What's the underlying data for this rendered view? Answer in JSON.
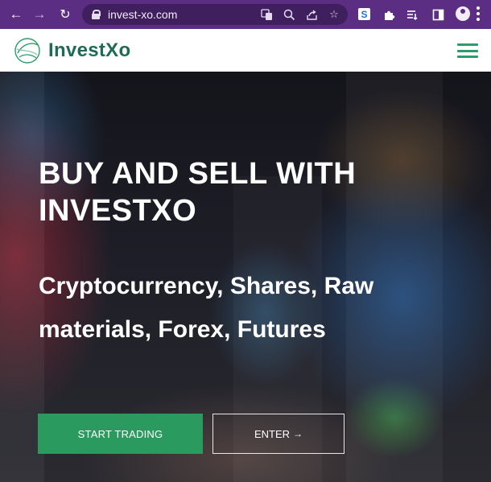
{
  "browser": {
    "back_icon": "arrow-left-icon",
    "forward_icon": "arrow-right-icon",
    "reload_icon": "reload-icon",
    "url": "invest-xo.com",
    "omnibox_icons": [
      "translate-icon",
      "zoom-icon",
      "share-icon",
      "star-icon"
    ],
    "extensions": [
      "s-extension-icon",
      "puzzle-icon",
      "reading-list-icon",
      "side-panel-icon"
    ],
    "profile_icon": "avatar-icon",
    "menu_icon": "kebab-menu-icon",
    "accent": "#5b2e84"
  },
  "header": {
    "logo_text": "InvestXo",
    "brand_color": "#1f6b55",
    "menu_icon": "hamburger-icon"
  },
  "hero": {
    "title": "BUY AND SELL WITH INVESTXO",
    "subtitle": "Cryptocurrency, Shares, Raw materials, Forex, Futures",
    "start_button": "START TRADING",
    "enter_button": "ENTER",
    "enter_arrow": "→",
    "button_color": "#2b9a5e"
  }
}
